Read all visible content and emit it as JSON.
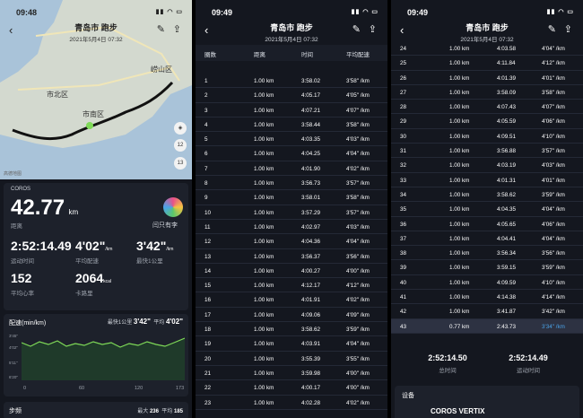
{
  "panel1": {
    "status": {
      "time": "09:48"
    },
    "header": {
      "title": "青岛市 跑步",
      "date": "2021年5月4日 07:32"
    },
    "map": {
      "labels": [
        "崂山区",
        "市北区",
        "市南区",
        "12",
        "13"
      ],
      "credit": "高德地图"
    },
    "brand": "COROS",
    "distance": {
      "value": "42.77",
      "unit": "km",
      "label": "距离"
    },
    "avatar_name": "闫只有李",
    "stats": [
      {
        "value": "2:52:14.49",
        "unit": "",
        "label": "运动时间"
      },
      {
        "value": "4'02\"",
        "unit": "/km",
        "label": "平均配速"
      },
      {
        "value": "3'42\"",
        "unit": "/km",
        "label": "最快1公里"
      },
      {
        "value": "152",
        "unit": "",
        "label": "平均心率"
      },
      {
        "value": "2064",
        "unit": "kcal",
        "label": "卡路里"
      }
    ],
    "pace": {
      "title": "配速(min/km)",
      "best_label": "最快1公里",
      "best": "3'42\"",
      "avg_label": "平均",
      "avg": "4'02\"",
      "y_ticks": [
        "3'45\"",
        "4'02\"",
        "5'11\"",
        "6'20\""
      ],
      "x_ticks": [
        "0",
        "60",
        "120",
        "173"
      ]
    },
    "cadence": {
      "title": "步频",
      "max_label": "最大",
      "max": "236",
      "avg_label": "平均",
      "avg": "185"
    }
  },
  "panel2": {
    "status": {
      "time": "09:49"
    },
    "header": {
      "title": "青岛市 跑步",
      "date": "2021年5月4日 07:32"
    },
    "columns": [
      "圈数",
      "距离",
      "时间",
      "平均配速"
    ],
    "rows": [
      [
        "1",
        "1.00 km",
        "3:58.02",
        "3'58\" /km"
      ],
      [
        "2",
        "1.00 km",
        "4:05.17",
        "4'05\" /km"
      ],
      [
        "3",
        "1.00 km",
        "4:07.21",
        "4'07\" /km"
      ],
      [
        "4",
        "1.00 km",
        "3:58.44",
        "3'58\" /km"
      ],
      [
        "5",
        "1.00 km",
        "4:03.35",
        "4'03\" /km"
      ],
      [
        "6",
        "1.00 km",
        "4:04.25",
        "4'04\" /km"
      ],
      [
        "7",
        "1.00 km",
        "4:01.90",
        "4'02\" /km"
      ],
      [
        "8",
        "1.00 km",
        "3:56.73",
        "3'57\" /km"
      ],
      [
        "9",
        "1.00 km",
        "3:58.01",
        "3'58\" /km"
      ],
      [
        "10",
        "1.00 km",
        "3:57.29",
        "3'57\" /km"
      ],
      [
        "11",
        "1.00 km",
        "4:02.97",
        "4'03\" /km"
      ],
      [
        "12",
        "1.00 km",
        "4:04.36",
        "4'04\" /km"
      ],
      [
        "13",
        "1.00 km",
        "3:56.37",
        "3'56\" /km"
      ],
      [
        "14",
        "1.00 km",
        "4:00.27",
        "4'00\" /km"
      ],
      [
        "15",
        "1.00 km",
        "4:12.17",
        "4'12\" /km"
      ],
      [
        "16",
        "1.00 km",
        "4:01.91",
        "4'02\" /km"
      ],
      [
        "17",
        "1.00 km",
        "4:09.06",
        "4'09\" /km"
      ],
      [
        "18",
        "1.00 km",
        "3:58.62",
        "3'59\" /km"
      ],
      [
        "19",
        "1.00 km",
        "4:03.91",
        "4'04\" /km"
      ],
      [
        "20",
        "1.00 km",
        "3:55.39",
        "3'55\" /km"
      ],
      [
        "21",
        "1.00 km",
        "3:59.98",
        "4'00\" /km"
      ],
      [
        "22",
        "1.00 km",
        "4:00.17",
        "4'00\" /km"
      ],
      [
        "23",
        "1.00 km",
        "4:02.28",
        "4'02\" /km"
      ]
    ]
  },
  "panel3": {
    "status": {
      "time": "09:49"
    },
    "header": {
      "title": "青岛市 跑步",
      "date": "2021年5月4日 07:32"
    },
    "rows": [
      [
        "24",
        "1.00 km",
        "4:03.58",
        "4'04\" /km"
      ],
      [
        "25",
        "1.00 km",
        "4:11.84",
        "4'12\" /km"
      ],
      [
        "26",
        "1.00 km",
        "4:01.39",
        "4'01\" /km"
      ],
      [
        "27",
        "1.00 km",
        "3:58.09",
        "3'58\" /km"
      ],
      [
        "28",
        "1.00 km",
        "4:07.43",
        "4'07\" /km"
      ],
      [
        "29",
        "1.00 km",
        "4:05.59",
        "4'06\" /km"
      ],
      [
        "30",
        "1.00 km",
        "4:09.51",
        "4'10\" /km"
      ],
      [
        "31",
        "1.00 km",
        "3:56.88",
        "3'57\" /km"
      ],
      [
        "32",
        "1.00 km",
        "4:03.19",
        "4'03\" /km"
      ],
      [
        "33",
        "1.00 km",
        "4:01.31",
        "4'01\" /km"
      ],
      [
        "34",
        "1.00 km",
        "3:58.62",
        "3'59\" /km"
      ],
      [
        "35",
        "1.00 km",
        "4:04.35",
        "4'04\" /km"
      ],
      [
        "36",
        "1.00 km",
        "4:05.65",
        "4'06\" /km"
      ],
      [
        "37",
        "1.00 km",
        "4:04.41",
        "4'04\" /km"
      ],
      [
        "38",
        "1.00 km",
        "3:56.34",
        "3'56\" /km"
      ],
      [
        "39",
        "1.00 km",
        "3:59.15",
        "3'59\" /km"
      ],
      [
        "40",
        "1.00 km",
        "4:09.59",
        "4'10\" /km"
      ],
      [
        "41",
        "1.00 km",
        "4:14.38",
        "4'14\" /km"
      ],
      [
        "42",
        "1.00 km",
        "3:41.87",
        "3'42\" /km"
      ],
      [
        "43",
        "0.77 km",
        "2:43.73",
        "3'34\" /km"
      ]
    ],
    "totals": [
      {
        "value": "2:52:14.50",
        "label": "总时间"
      },
      {
        "value": "2:52:14.49",
        "label": "运动时间"
      }
    ],
    "device": {
      "title": "设备",
      "name": "COROS VERTIX"
    }
  }
}
